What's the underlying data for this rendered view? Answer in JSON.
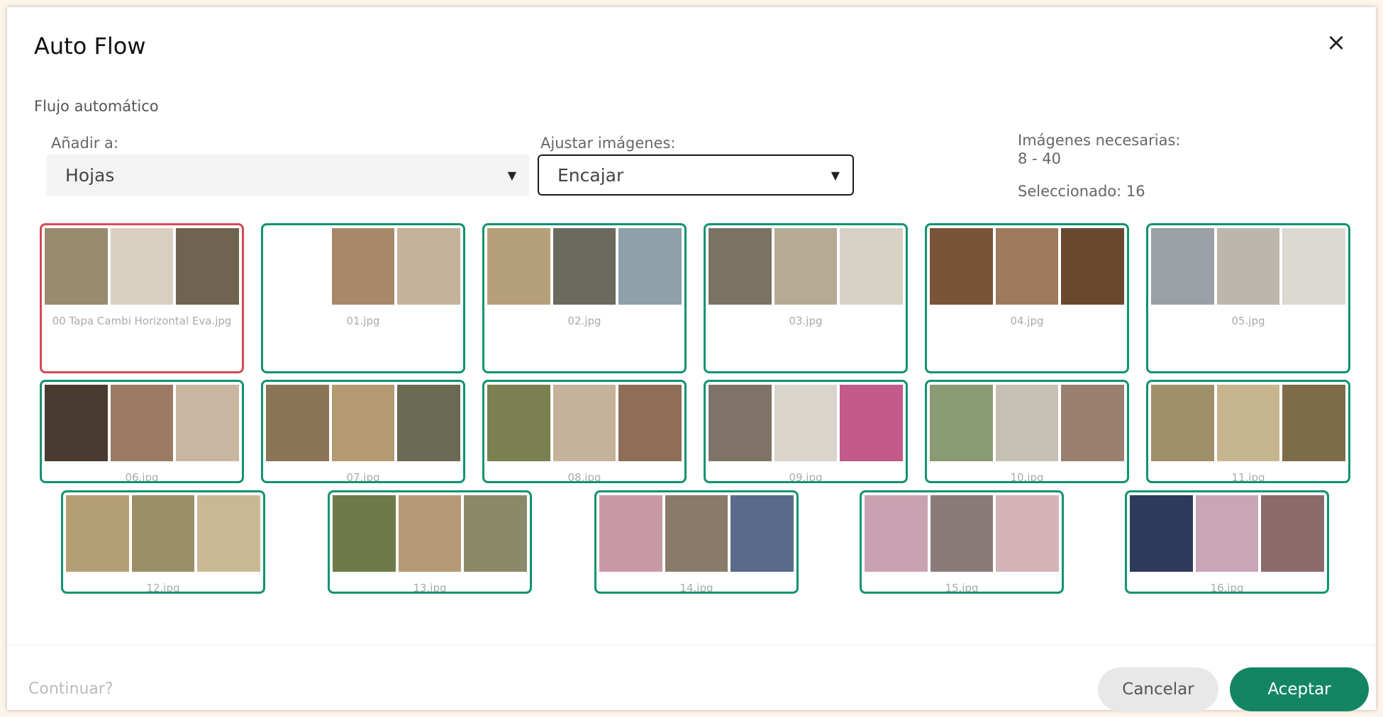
{
  "dialog": {
    "title": "Auto Flow",
    "close_glyph": "×",
    "subtitle": "Flujo automático"
  },
  "add_to": {
    "label": "Añadir a:",
    "value": "Hojas"
  },
  "fit": {
    "label": "Ajustar imágenes:",
    "value": "Encajar"
  },
  "info": {
    "required_label": "Imágenes necesarias:",
    "required_range": "8 - 40",
    "selected": "Seleccionado: 16"
  },
  "thumbnails": [
    {
      "name": "00 Tapa Cambi Horizontal Eva.jpg",
      "selected": true,
      "colors": [
        "#9a8a6f",
        "#d8cfc1",
        "#6e6450"
      ]
    },
    {
      "name": "01.jpg",
      "colors": [
        "#ffffff",
        "#a78868",
        "#c4b29b"
      ]
    },
    {
      "name": "02.jpg",
      "colors": [
        "#b6a07a",
        "#6b6a5e",
        "#8ea0a8"
      ]
    },
    {
      "name": "03.jpg",
      "colors": [
        "#7b7362",
        "#b6aa94",
        "#d8d2c4"
      ]
    },
    {
      "name": "04.jpg",
      "colors": [
        "#7a5438",
        "#9d7a5d",
        "#6a4830"
      ]
    },
    {
      "name": "05.jpg",
      "colors": [
        "#9aa0a6",
        "#bcb6ac",
        "#dcd8d2"
      ]
    },
    {
      "name": "06.jpg",
      "colors": [
        "#4a3b30",
        "#9a7a62",
        "#c9b6a0"
      ]
    },
    {
      "name": "07.jpg",
      "colors": [
        "#8a7556",
        "#b49a70",
        "#6b6a52"
      ]
    },
    {
      "name": "08.jpg",
      "colors": [
        "#7a8050",
        "#c4b29a",
        "#8e6e58"
      ]
    },
    {
      "name": "09.jpg",
      "colors": [
        "#7e7366",
        "#d9d4cc",
        "#c25a8a"
      ]
    },
    {
      "name": "10.jpg",
      "colors": [
        "#8a9a72",
        "#c6c0b4",
        "#9a7e6e"
      ]
    },
    {
      "name": "11.jpg",
      "colors": [
        "#a0906a",
        "#c7b58f",
        "#7d6b4a"
      ]
    },
    {
      "name": "12.jpg",
      "colors": [
        "#b49e76",
        "#9c8f68",
        "#c8b894"
      ]
    },
    {
      "name": "13.jpg",
      "colors": [
        "#6e7a4a",
        "#b69a76",
        "#8a8a6a"
      ]
    },
    {
      "name": "14.jpg",
      "colors": [
        "#c89aa6",
        "#8a7a6a",
        "#5a6a8a"
      ]
    },
    {
      "name": "15.jpg",
      "colors": [
        "#c8a2b0",
        "#8a7a7a",
        "#d4b4b8"
      ]
    },
    {
      "name": "16.jpg",
      "colors": [
        "#2d3a5a",
        "#c8a6b6",
        "#8a6a6a"
      ]
    }
  ],
  "footer": {
    "continue": "Continuar?",
    "cancel": "Cancelar",
    "accept": "Aceptar"
  }
}
